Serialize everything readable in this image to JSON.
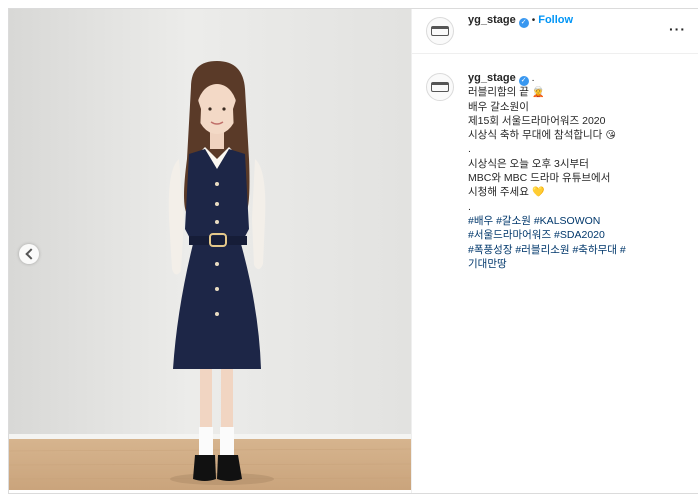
{
  "post": {
    "username": "yg_stage",
    "follow_label": "Follow",
    "separator": "•",
    "more_label": "···",
    "verified_glyph": "✓"
  },
  "caption": {
    "username": "yg_stage",
    "after_name": ".",
    "lines": [
      {
        "text": "러블리함의 끝",
        "emoji": "🧝"
      },
      {
        "text": "배우 갈소원이"
      },
      {
        "text": "제15회 서울드라마어워즈 2020"
      },
      {
        "text": "시상식 축하 무대에 참석합니다",
        "emoji": "😘"
      },
      {
        "text": "."
      },
      {
        "text": "시상식은 오늘 오후 3시부터"
      },
      {
        "text": "MBC와 MBC 드라마 유튜브에서"
      },
      {
        "text": "시청해 주세요",
        "emoji": "💛"
      },
      {
        "text": "."
      }
    ],
    "hashtag_lines": [
      [
        "#배우",
        "#갈소원",
        "#KALSOWON"
      ],
      [
        "#서울드라마어워즈",
        "#SDA2020"
      ],
      [
        "#폭풍성장",
        "#러블리소원",
        "#축하무대",
        "#"
      ],
      [
        "기대만땅"
      ]
    ]
  },
  "icons": {
    "avatar": "yg-stage-logo-icon",
    "verified": "verified-badge-icon",
    "carousel": "chevron-left-icon",
    "more": "more-options-icon"
  },
  "colors": {
    "follow": "#0095f6",
    "hashtag": "#00376b",
    "verified": "#3897f0",
    "dress": "#1d2647",
    "floor": "#d9b995"
  }
}
